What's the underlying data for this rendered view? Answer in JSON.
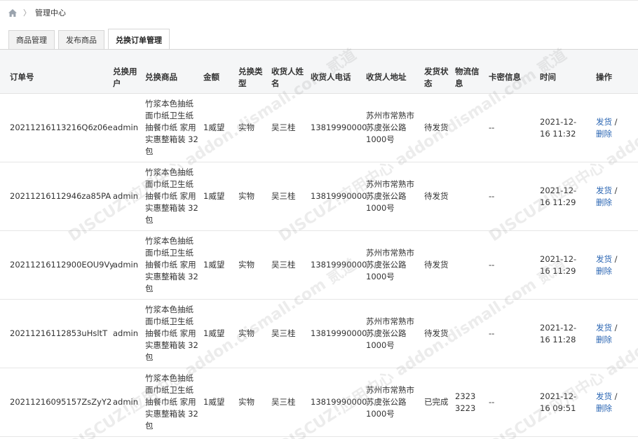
{
  "breadcrumb": {
    "current": "管理中心"
  },
  "tabs": [
    {
      "label": "商品管理"
    },
    {
      "label": "发布商品"
    },
    {
      "label": "兑换订单管理"
    }
  ],
  "table": {
    "headers": {
      "order_no": "订单号",
      "user": "兑换用户",
      "product": "兑换商品",
      "amount": "金额",
      "type": "兑换类型",
      "receiver": "收货人姓名",
      "phone": "收货人电话",
      "address": "收货人地址",
      "ship_status": "发货状态",
      "logistics": "物流信息",
      "card": "卡密信息",
      "time": "时间",
      "ops": "操作"
    },
    "rows": [
      {
        "order_no": "20211216113216Q6z06e",
        "user": "admin",
        "product": "竹浆本色抽纸面巾纸卫生纸抽餐巾纸 家用实惠整箱装 32包",
        "amount": "1威望",
        "type": "实物",
        "receiver": "吴三桂",
        "phone": "13819990000",
        "address": "苏州市常熟市苏虞张公路1000号",
        "ship_status": "待发货",
        "logistics": "",
        "card": "--",
        "time": "2021-12-16 11:32",
        "ship_action": "发货",
        "delete_action": "删除"
      },
      {
        "order_no": "20211216112946za85PA",
        "user": "admin",
        "product": "竹浆本色抽纸面巾纸卫生纸抽餐巾纸 家用实惠整箱装 32包",
        "amount": "1威望",
        "type": "实物",
        "receiver": "吴三桂",
        "phone": "13819990000",
        "address": "苏州市常熟市苏虞张公路1000号",
        "ship_status": "待发货",
        "logistics": "",
        "card": "--",
        "time": "2021-12-16 11:29",
        "ship_action": "发货",
        "delete_action": "删除"
      },
      {
        "order_no": "20211216112900EOU9Vy",
        "user": "admin",
        "product": "竹浆本色抽纸面巾纸卫生纸抽餐巾纸 家用实惠整箱装 32包",
        "amount": "1威望",
        "type": "实物",
        "receiver": "吴三桂",
        "phone": "13819990000",
        "address": "苏州市常熟市苏虞张公路1000号",
        "ship_status": "待发货",
        "logistics": "",
        "card": "--",
        "time": "2021-12-16 11:29",
        "ship_action": "发货",
        "delete_action": "删除"
      },
      {
        "order_no": "20211216112853uHsltT",
        "user": "admin",
        "product": "竹浆本色抽纸面巾纸卫生纸抽餐巾纸 家用实惠整箱装 32包",
        "amount": "1威望",
        "type": "实物",
        "receiver": "吴三桂",
        "phone": "13819990000",
        "address": "苏州市常熟市苏虞张公路1000号",
        "ship_status": "待发货",
        "logistics": "",
        "card": "--",
        "time": "2021-12-16 11:28",
        "ship_action": "发货",
        "delete_action": "删除"
      },
      {
        "order_no": "20211216095157ZsZyY2",
        "user": "admin",
        "product": "竹浆本色抽纸面巾纸卫生纸抽餐巾纸 家用实惠整箱装 32包",
        "amount": "1威望",
        "type": "实物",
        "receiver": "吴三桂",
        "phone": "13819990000",
        "address": "苏州市常熟市苏虞张公路1000号",
        "ship_status": "已完成",
        "logistics": "2323 3223",
        "card": "--",
        "time": "2021-12-16 09:51",
        "ship_action": "发货",
        "delete_action": "删除"
      }
    ]
  },
  "watermark_text": "DISCUZ!应用中心 addon.dismall.com 贰道"
}
